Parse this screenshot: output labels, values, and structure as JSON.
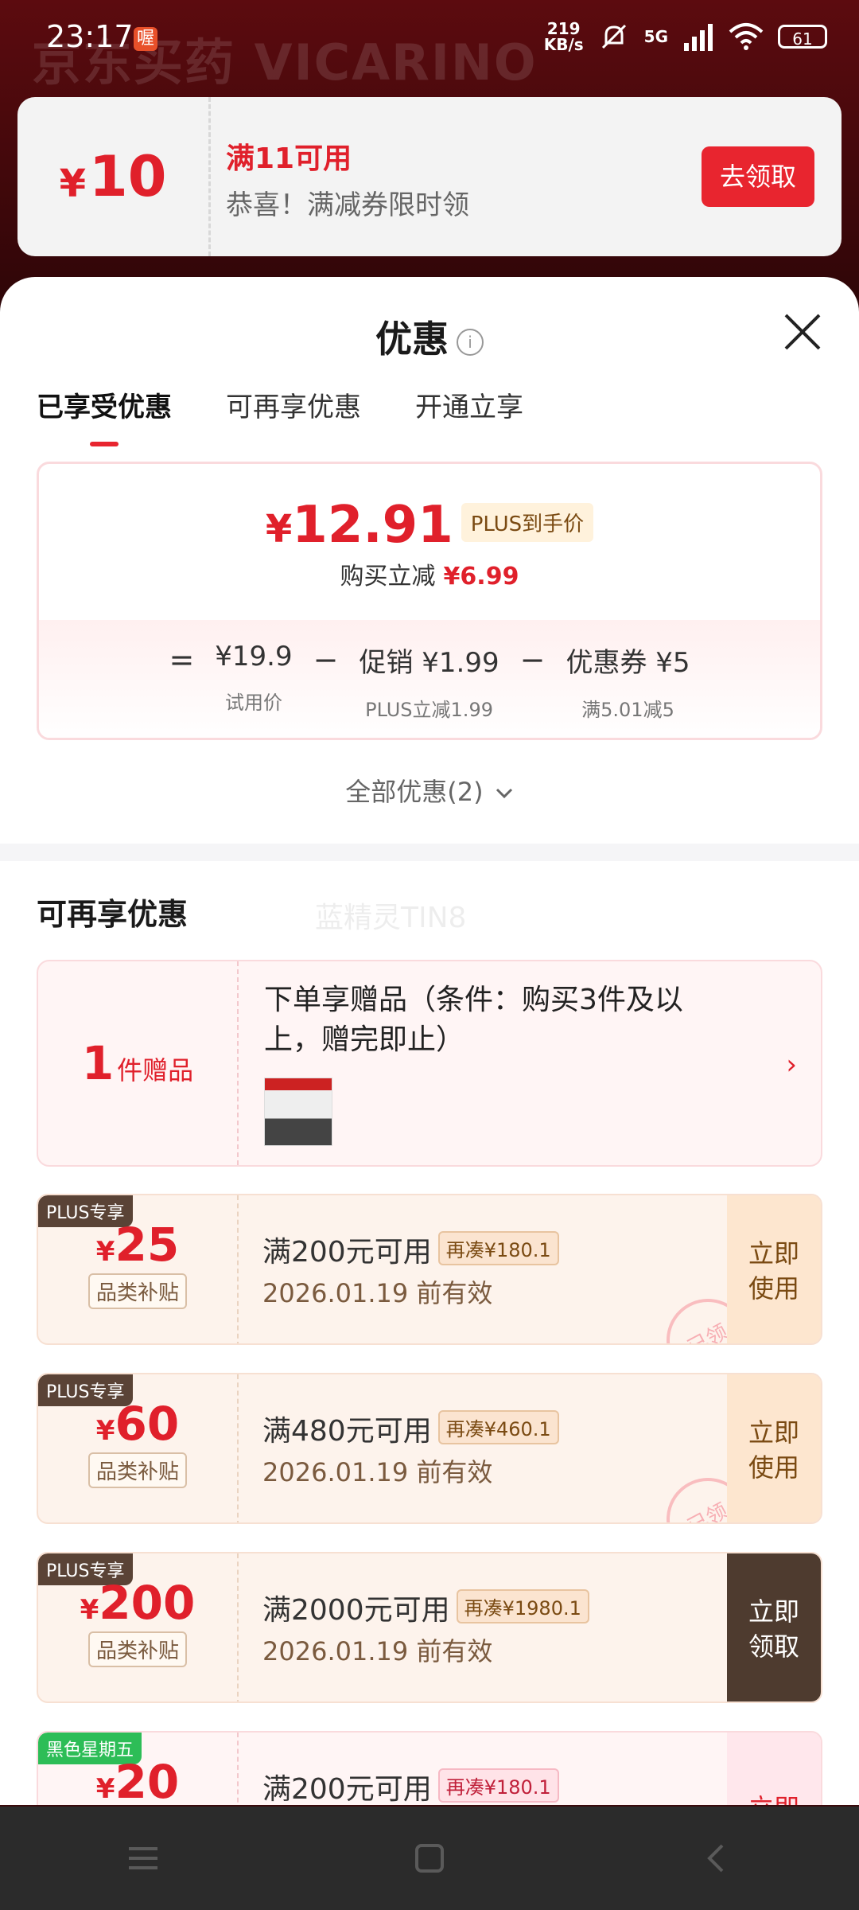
{
  "status_bar": {
    "time": "23:17",
    "app_badge": "喔",
    "speed": "219\nKB/s",
    "network": "5G",
    "battery": "61"
  },
  "background": {
    "title": "京东买药 VICARINO"
  },
  "top_coupon": {
    "yen": "¥",
    "amount": "10",
    "title": "满11可用",
    "subtitle": "恭喜！满减券限时领",
    "button": "去领取"
  },
  "sheet": {
    "title": "优惠",
    "tabs": [
      "已享受优惠",
      "可再享优惠",
      "开通立享"
    ],
    "summary": {
      "yen": "¥",
      "price": "12.91",
      "plus_tag": "PLUS到手价",
      "reduce_label": "购买立减",
      "reduce_value": "¥6.99",
      "equals": "=",
      "minus": "−",
      "items": [
        {
          "value": "¥19.9",
          "sub": "试用价"
        },
        {
          "value": "促销 ¥1.99",
          "sub": "PLUS立减1.99"
        },
        {
          "value": "优惠券 ¥5",
          "sub": "满5.01减5"
        }
      ]
    },
    "all_promos": "全部优惠(2)",
    "section_title": "可再享优惠",
    "watermark": "蓝精灵TIN8",
    "gift": {
      "count": "1",
      "unit": "件赠品",
      "text": "下单享赠品（条件：购买3件及以上，赠完即止）",
      "arrow": "›"
    },
    "coupons": [
      {
        "badge": "PLUS专享",
        "yen": "¥",
        "amount": "25",
        "tag": "品类补贴",
        "title": "满200元可用",
        "extra": "再凑¥180.1",
        "date": "2026.01.19 前有效",
        "action": "立即\n使用",
        "stamp": "已领"
      },
      {
        "badge": "PLUS专享",
        "yen": "¥",
        "amount": "60",
        "tag": "品类补贴",
        "title": "满480元可用",
        "extra": "再凑¥460.1",
        "date": "2026.01.19 前有效",
        "action": "立即\n使用",
        "stamp": "已领"
      },
      {
        "badge": "PLUS专享",
        "yen": "¥",
        "amount": "200",
        "tag": "品类补贴",
        "title": "满2000元可用",
        "extra": "再凑¥1980.1",
        "date": "2026.01.19 前有效",
        "action": "立即\n领取"
      },
      {
        "badge": "黑色星期五",
        "yen": "¥",
        "amount": "20",
        "title": "满200元可用",
        "extra": "再凑¥180.1",
        "action": "立即"
      }
    ]
  },
  "nav_icons": [
    "menu-icon",
    "home-icon",
    "back-icon"
  ]
}
